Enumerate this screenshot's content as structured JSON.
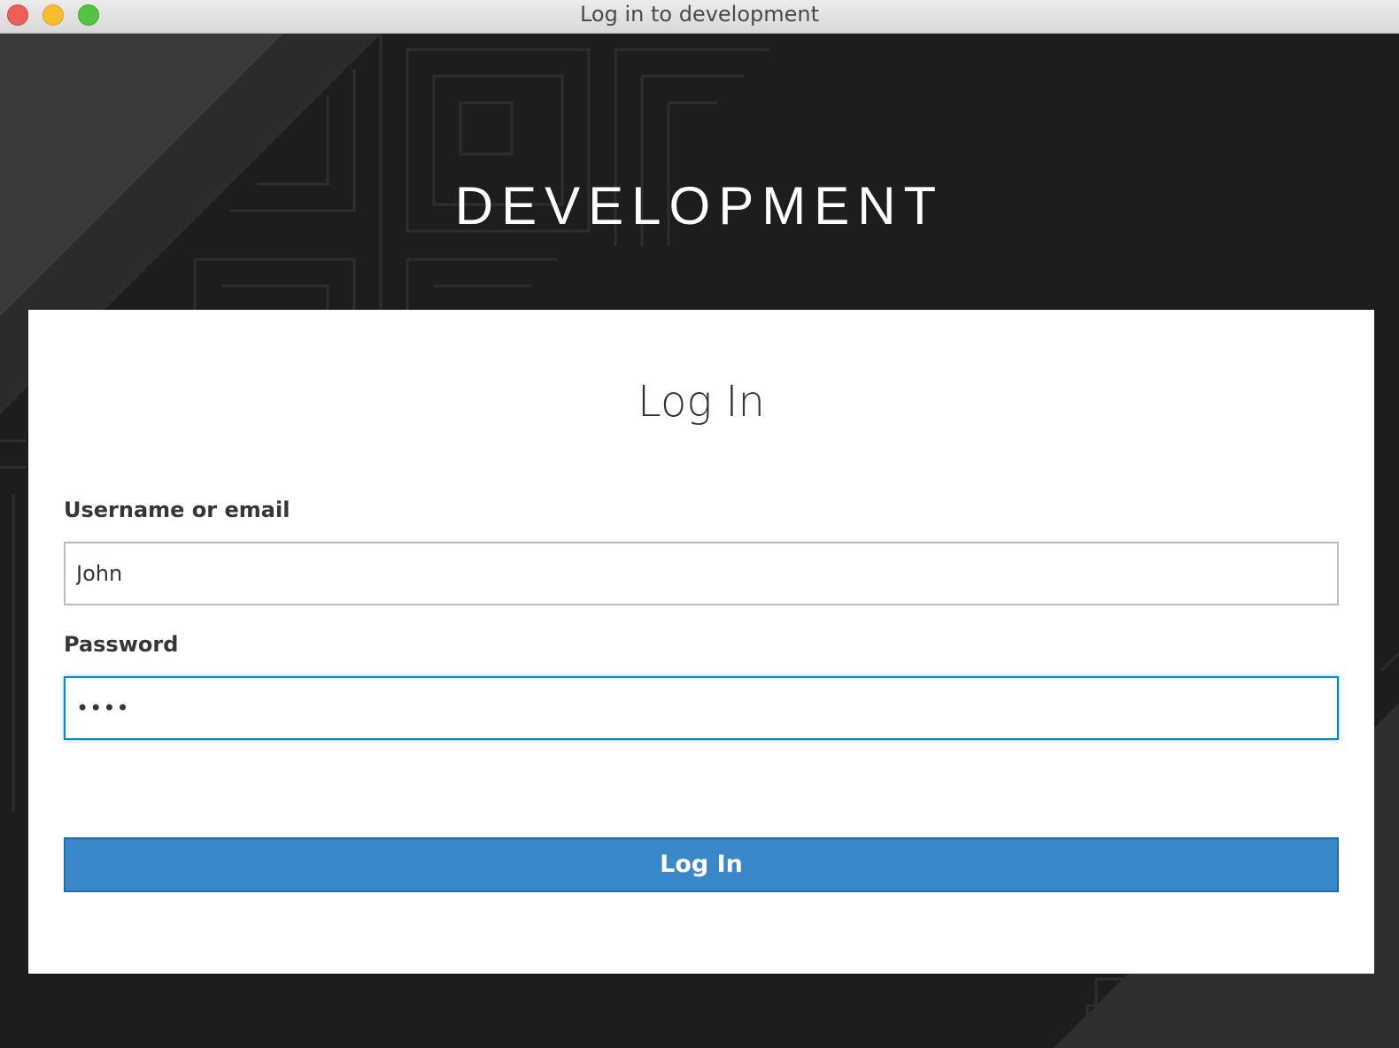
{
  "window": {
    "title": "Log in to development"
  },
  "brand": {
    "text": "DEVELOPMENT"
  },
  "login": {
    "title": "Log In",
    "username_label": "Username or email",
    "username_value": "John",
    "password_label": "Password",
    "password_value": "••••",
    "submit_label": "Log In"
  },
  "colors": {
    "background": "#1d1d1d",
    "card": "#ffffff",
    "button": "#3a87c9",
    "focus": "#0088ce"
  }
}
